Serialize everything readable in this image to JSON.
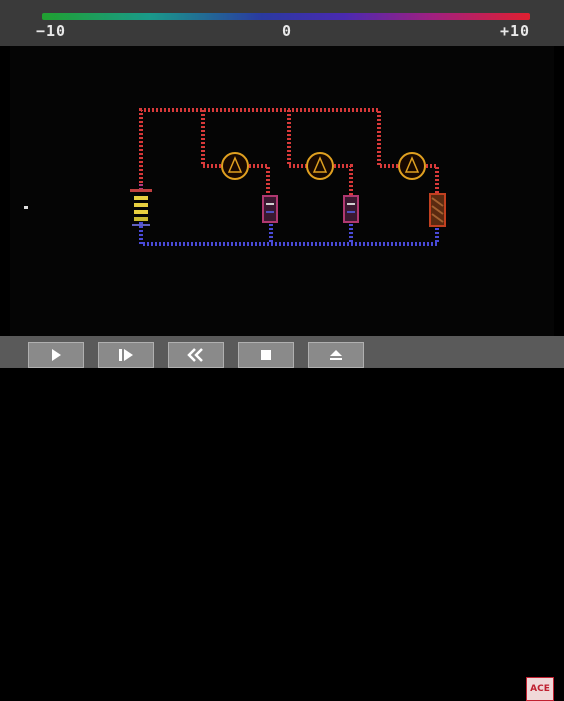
{
  "scale": {
    "min_label": "−10",
    "zero_label": "0",
    "max_label": "+10"
  },
  "toolbar": {
    "buttons": [
      {
        "name": "play",
        "icon": "play-icon"
      },
      {
        "name": "step",
        "icon": "step-forward-icon"
      },
      {
        "name": "rewind",
        "icon": "rewind-icon"
      },
      {
        "name": "stop",
        "icon": "stop-icon"
      },
      {
        "name": "eject",
        "icon": "eject-icon"
      }
    ]
  },
  "logo": {
    "text": "ACE",
    "icon": "app-logo-icon"
  },
  "colors": {
    "wire_high": "#d83a3a",
    "wire_low": "#4a4ad8",
    "wire_mid": "#b03880",
    "bulb": "#e0a020",
    "gradient_start": "#20a030",
    "gradient_end": "#e02030"
  }
}
